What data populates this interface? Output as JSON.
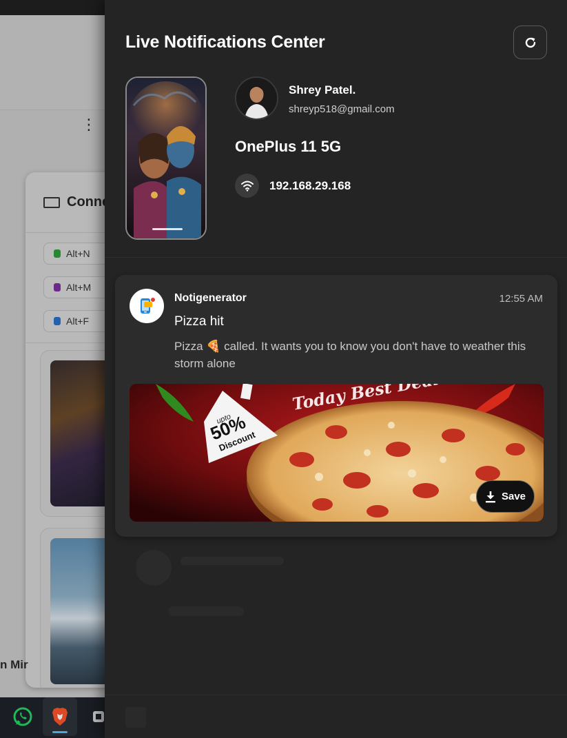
{
  "drawer": {
    "title": "Live Notifications Center",
    "refresh_icon": "refresh-icon"
  },
  "user": {
    "name": "Shrey Patel.",
    "email": "shreyp518@gmail.com"
  },
  "device": {
    "name": "OnePlus 11 5G",
    "ip": "192.168.29.168",
    "connection_icon": "wifi-icon"
  },
  "notification": {
    "app_name": "Notigenerator",
    "time": "12:55 AM",
    "title": "Pizza hit",
    "body": "Pizza 🍕 called. It wants you to know you don't have to weather this storm alone",
    "image_text": {
      "badge_top": "upto",
      "badge_value": "50%",
      "badge_bottom": "Discount",
      "headline": "Today Best Deal"
    },
    "save_label": "Save"
  },
  "background": {
    "panel_title": "Conne",
    "shortcuts": [
      "Alt+N",
      "Alt+M",
      "Alt+F"
    ],
    "side_text": "n Mir"
  },
  "colors": {
    "drawer_bg": "#242424",
    "card_bg": "#2c2c2c",
    "accent_pizza": "#c4161c"
  }
}
